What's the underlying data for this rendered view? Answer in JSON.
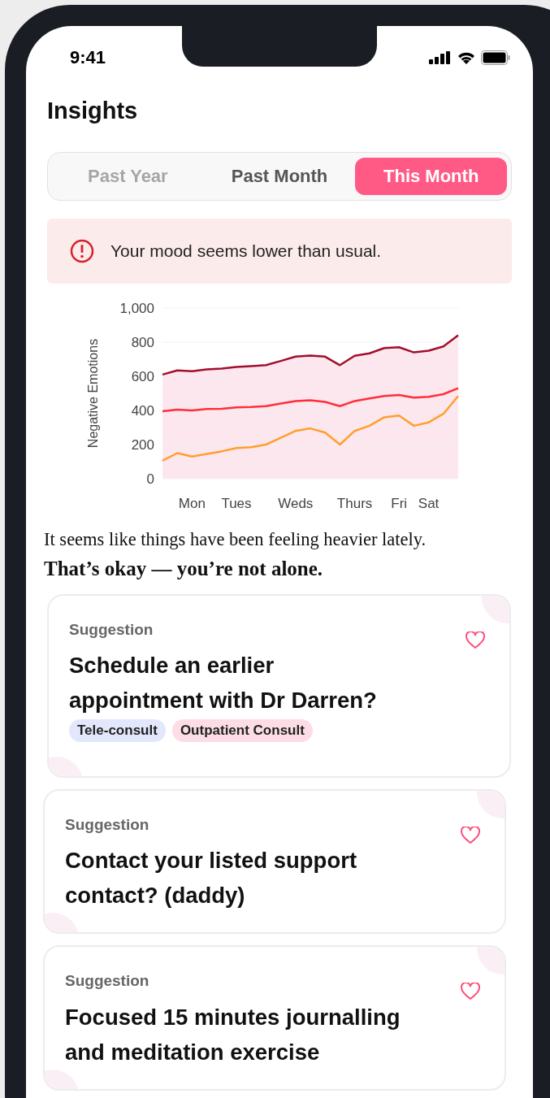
{
  "status_bar": {
    "time": "9:41"
  },
  "title": "Insights",
  "tabs": [
    {
      "label": "Past Year",
      "selected": false,
      "disabled": true
    },
    {
      "label": "Past Month",
      "selected": false,
      "disabled": false
    },
    {
      "label": "This Month",
      "selected": true,
      "disabled": false
    }
  ],
  "alert": {
    "message": "Your mood seems lower than usual."
  },
  "chart": {
    "chart_data": {
      "type": "line",
      "ylabel": "Negative Emotions",
      "categories": [
        null,
        null,
        "Mon",
        null,
        null,
        "Tues",
        null,
        null,
        null,
        "Weds",
        null,
        null,
        null,
        "Thurs",
        null,
        null,
        "Fri",
        null,
        "Sat",
        null,
        null
      ],
      "ylim": [
        0,
        1000
      ],
      "grid": true,
      "yticks": [
        0,
        200,
        400,
        600,
        800,
        {
          "value": 1000,
          "label": "1,000"
        }
      ],
      "series": [
        {
          "color": "#a10f2b",
          "values": [
            610,
            635,
            630,
            640,
            645,
            655,
            660,
            665,
            690,
            715,
            722,
            715,
            665,
            720,
            735,
            765,
            770,
            740,
            750,
            775,
            840
          ]
        },
        {
          "color": "#ff2e3a",
          "values": [
            395,
            405,
            400,
            408,
            410,
            418,
            420,
            425,
            440,
            455,
            460,
            450,
            425,
            455,
            470,
            485,
            490,
            475,
            480,
            495,
            530
          ]
        },
        {
          "color": "#ff9f2e",
          "values": [
            105,
            150,
            130,
            145,
            160,
            180,
            185,
            200,
            240,
            280,
            295,
            270,
            200,
            280,
            310,
            360,
            370,
            310,
            330,
            380,
            485
          ]
        }
      ]
    }
  },
  "message": {
    "line_1": "It seems like things have been feeling heavier lately.",
    "line_2": "That’s okay — you’re not alone."
  },
  "suggestions": [
    {
      "label": "Suggestion",
      "title": "Schedule an earlier appointment with Dr Darren?",
      "favorited": false,
      "tags": [
        {
          "label": "Tele-consult",
          "color": "#e2e7fb"
        },
        {
          "label": "Outpatient Consult",
          "color": "#fcdde5"
        }
      ]
    },
    {
      "label": "Suggestion",
      "title": "Contact your listed support contact? (daddy)",
      "favorited": false
    },
    {
      "label": "Suggestion",
      "title": "Focused 15 minutes journalling and meditation exercise",
      "favorited": false
    }
  ]
}
